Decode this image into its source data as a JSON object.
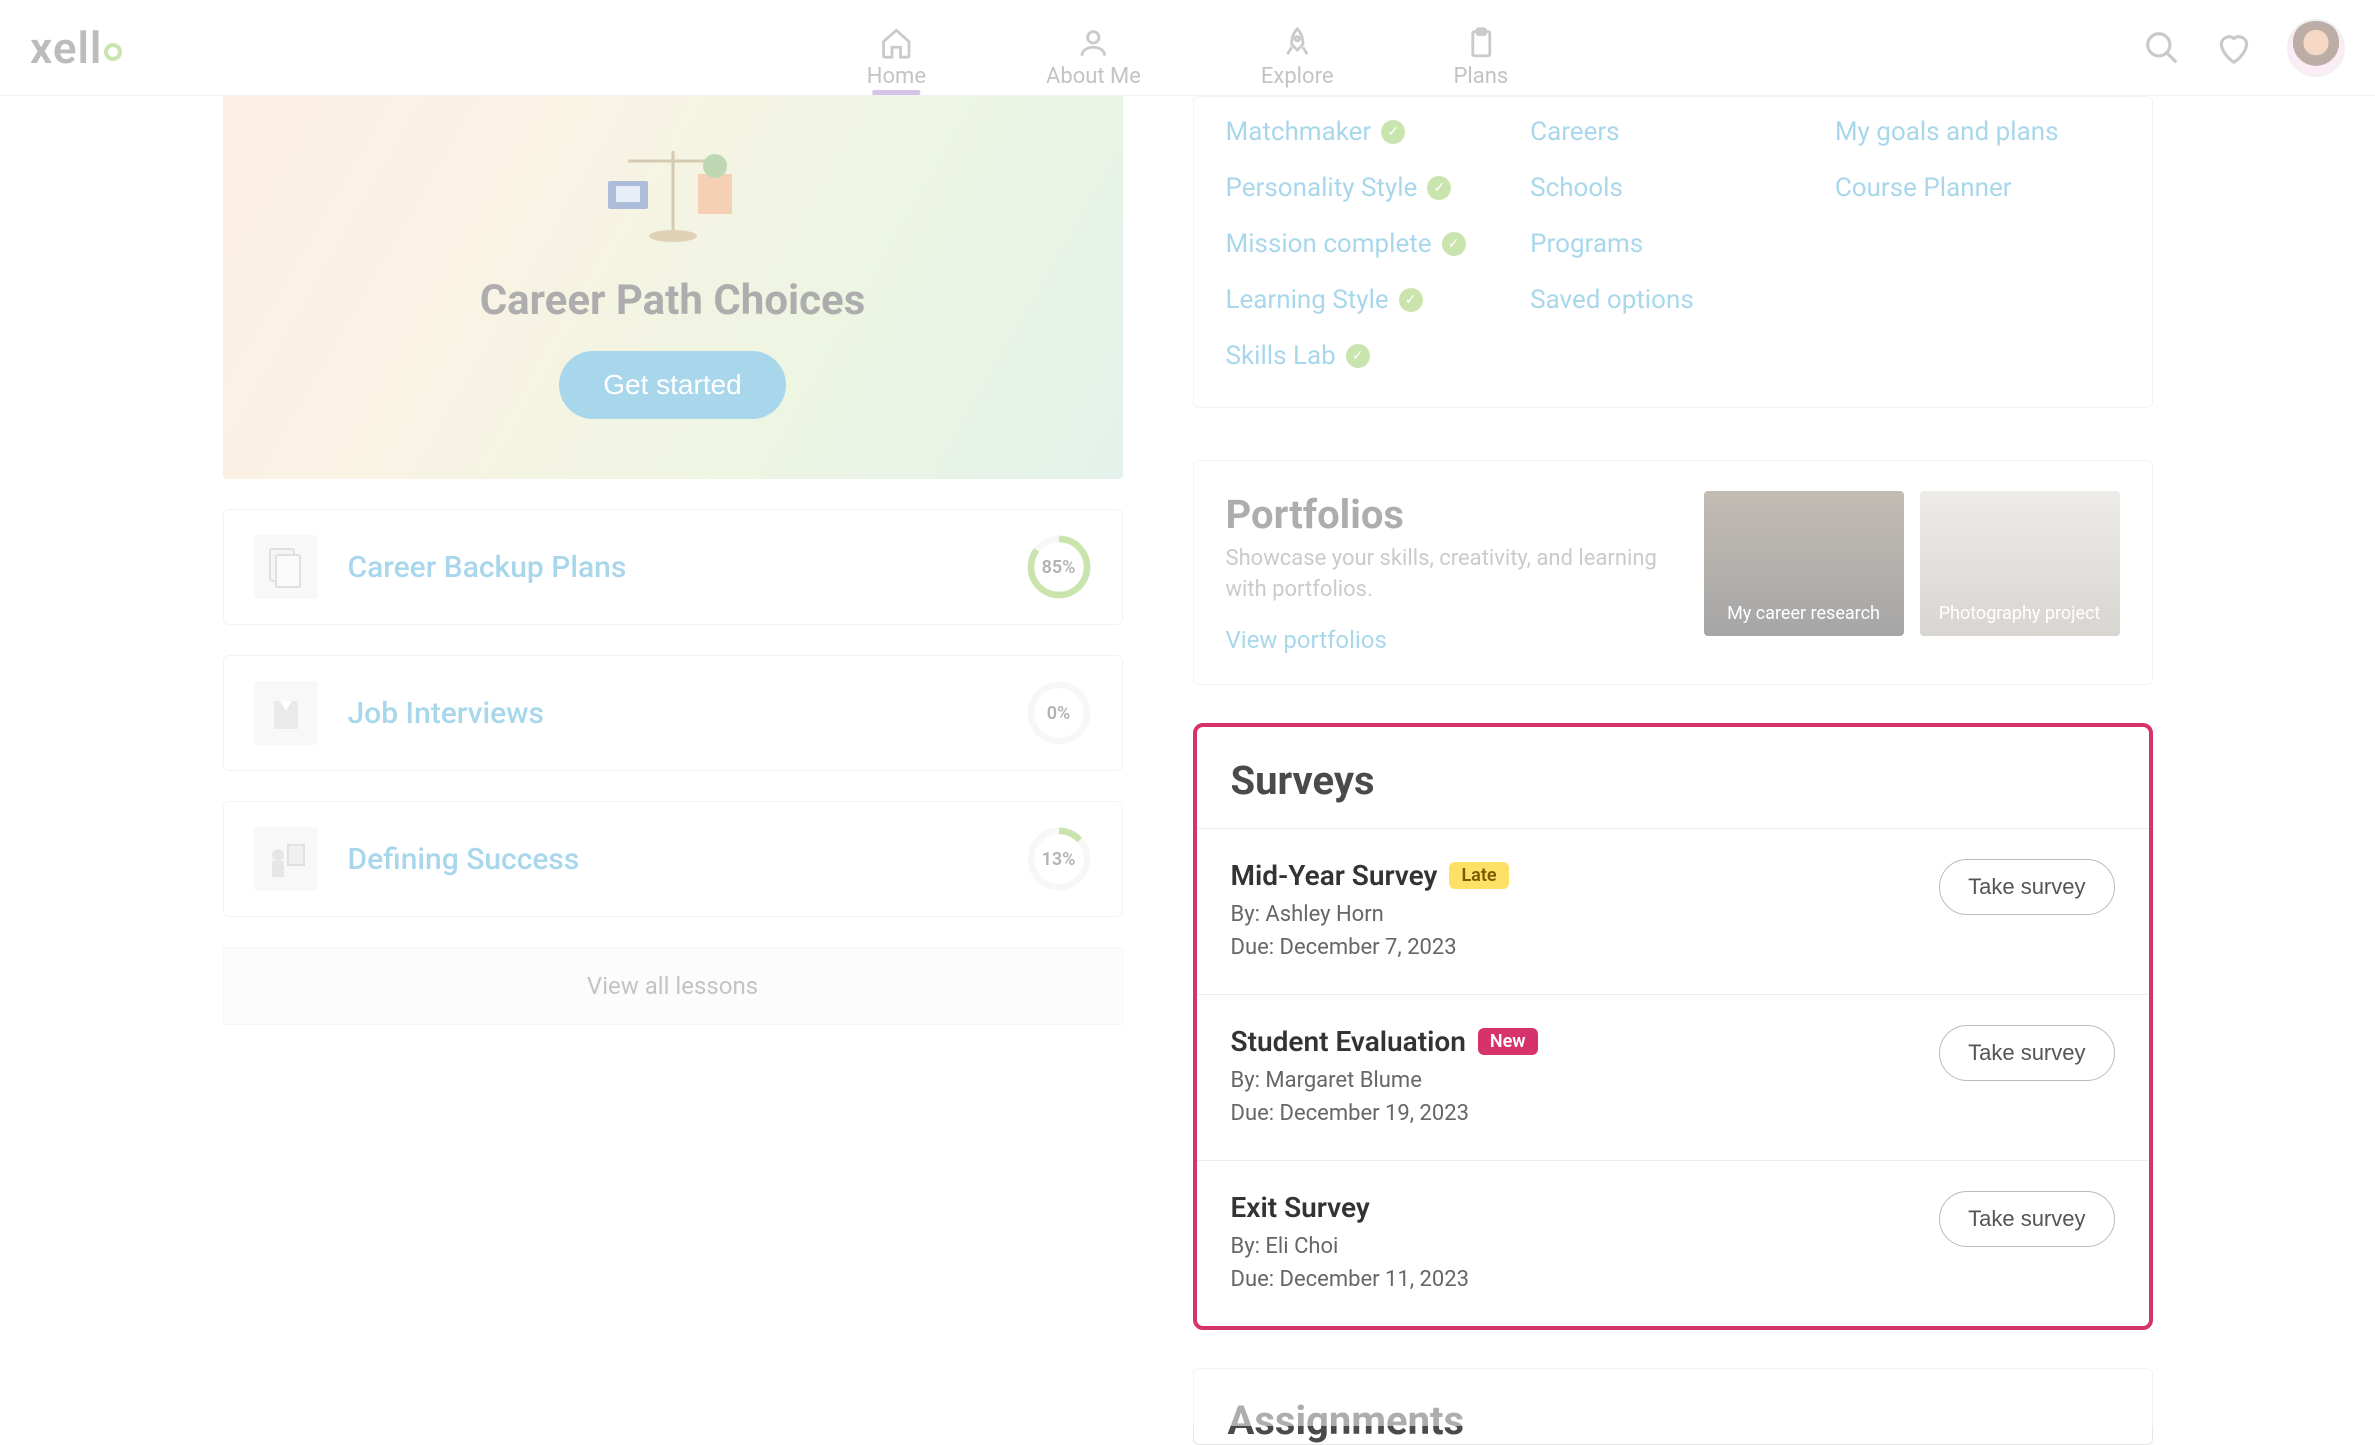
{
  "nav": {
    "logo_prefix": "xell",
    "items": [
      {
        "label": "Home",
        "icon": "home",
        "active": true
      },
      {
        "label": "About Me",
        "icon": "person",
        "active": false
      },
      {
        "label": "Explore",
        "icon": "rocket",
        "active": false
      },
      {
        "label": "Plans",
        "icon": "clipboard",
        "active": false
      }
    ]
  },
  "hero": {
    "title": "Career Path Choices",
    "button": "Get started"
  },
  "lessons": [
    {
      "name": "Career Backup Plans",
      "percent": "85%",
      "percent_num": 85
    },
    {
      "name": "Job Interviews",
      "percent": "0%",
      "percent_num": 0
    },
    {
      "name": "Defining Success",
      "percent": "13%",
      "percent_num": 13
    }
  ],
  "view_all_lessons": "View all lessons",
  "links_card": {
    "col1": [
      {
        "label": "Matchmaker",
        "checked": true
      },
      {
        "label": "Personality Style",
        "checked": true
      },
      {
        "label": "Mission complete",
        "checked": true
      },
      {
        "label": "Learning Style",
        "checked": true
      },
      {
        "label": "Skills Lab",
        "checked": true
      }
    ],
    "col2": [
      {
        "label": "Careers",
        "checked": false
      },
      {
        "label": "Schools",
        "checked": false
      },
      {
        "label": "Programs",
        "checked": false
      },
      {
        "label": "Saved options",
        "checked": false
      }
    ],
    "col3": [
      {
        "label": "My goals and plans",
        "checked": false
      },
      {
        "label": "Course Planner",
        "checked": false
      }
    ]
  },
  "portfolios": {
    "title": "Portfolios",
    "desc": "Showcase your skills, creativity, and learning with portfolios.",
    "link": "View portfolios",
    "thumbs": [
      {
        "label": "My career research"
      },
      {
        "label": "Photography project"
      }
    ]
  },
  "surveys": {
    "title": "Surveys",
    "take_label": "Take survey",
    "by_prefix": "By: ",
    "due_prefix": "Due: ",
    "items": [
      {
        "name": "Mid-Year Survey",
        "badge": "Late",
        "badge_type": "late",
        "by": "Ashley Horn",
        "due": "December 7, 2023"
      },
      {
        "name": "Student Evaluation",
        "badge": "New",
        "badge_type": "new",
        "by": "Margaret Blume",
        "due": "December 19, 2023"
      },
      {
        "name": "Exit Survey",
        "badge": "",
        "badge_type": "",
        "by": "Eli Choi",
        "due": "December 11, 2023"
      }
    ]
  },
  "assignments": {
    "title": "Assignments"
  },
  "colors": {
    "accent_blue": "#3ea6d6",
    "accent_green": "#8bc34a",
    "highlight_pink": "#d6336c",
    "badge_yellow": "#ffe066"
  }
}
